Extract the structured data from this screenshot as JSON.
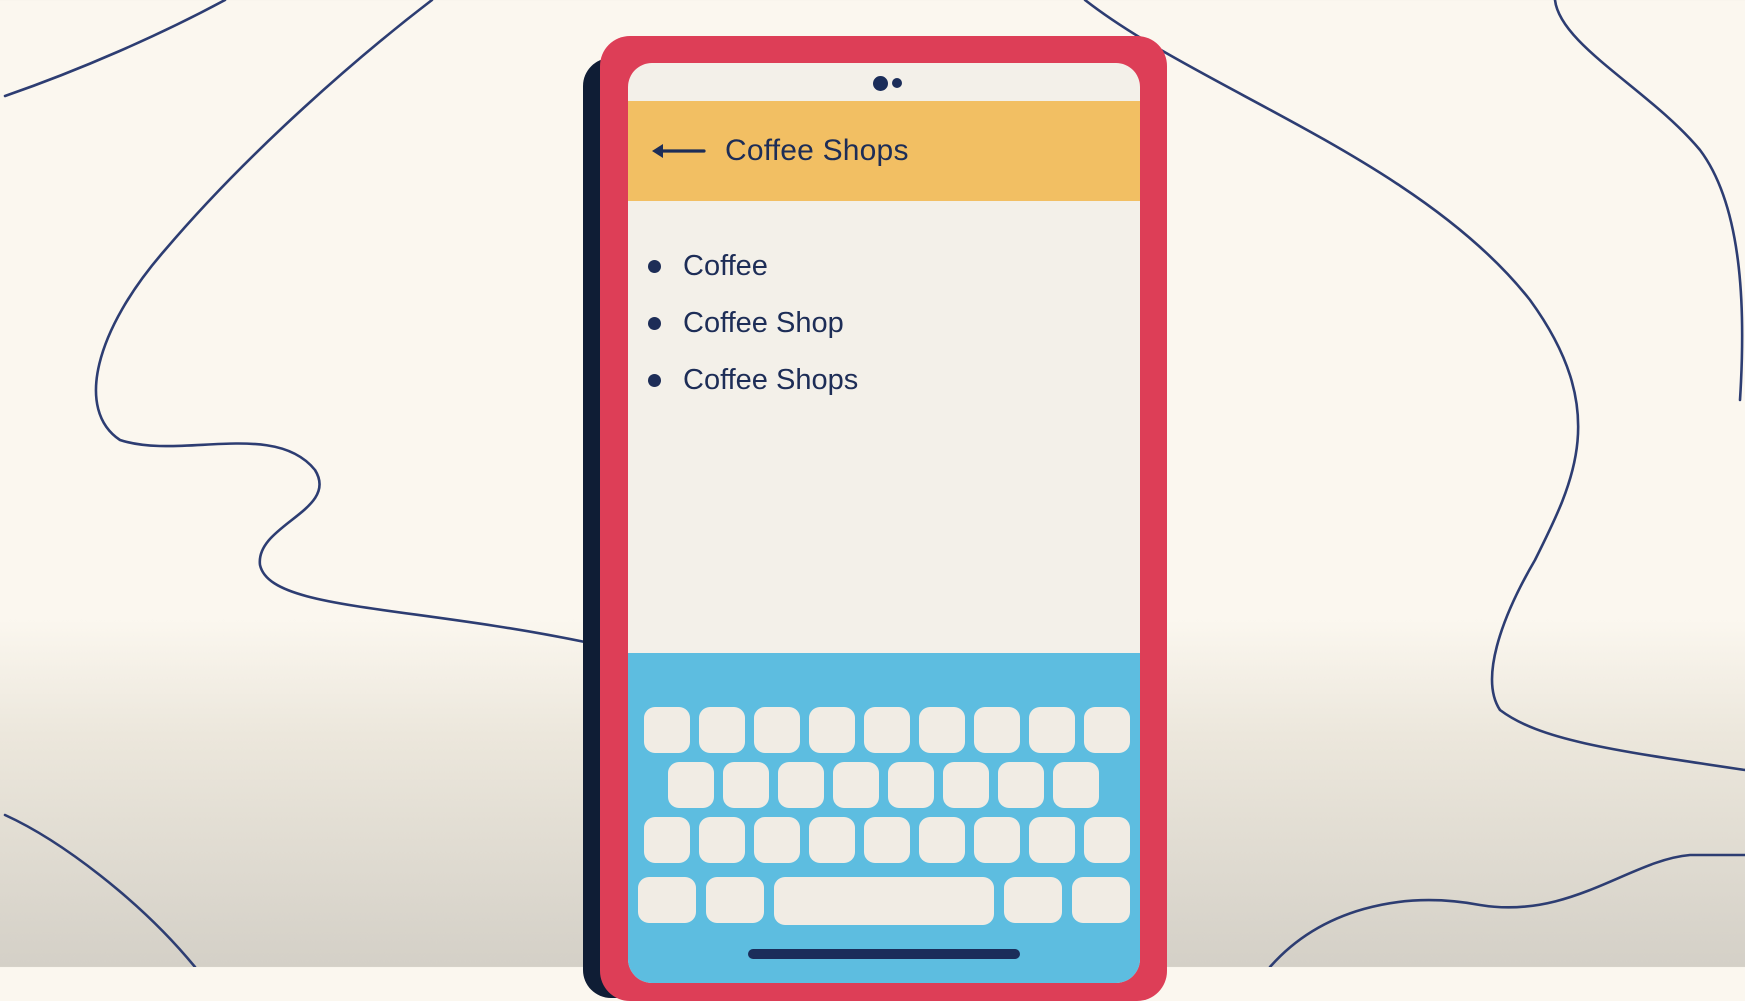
{
  "header": {
    "title": "Coffee Shops",
    "back_icon": "arrow-left-icon"
  },
  "results": {
    "items": [
      {
        "label": "Coffee"
      },
      {
        "label": "Coffee Shop"
      },
      {
        "label": "Coffee Shops"
      }
    ]
  },
  "colors": {
    "background": "#fbf7ef",
    "line": "#2d3d72",
    "phone_shell": "#dd3e57",
    "phone_shadow": "#0f1d35",
    "header": "#f2bf63",
    "text": "#1d2d57",
    "keyboard": "#5dbde0",
    "key": "#f1ece4"
  }
}
